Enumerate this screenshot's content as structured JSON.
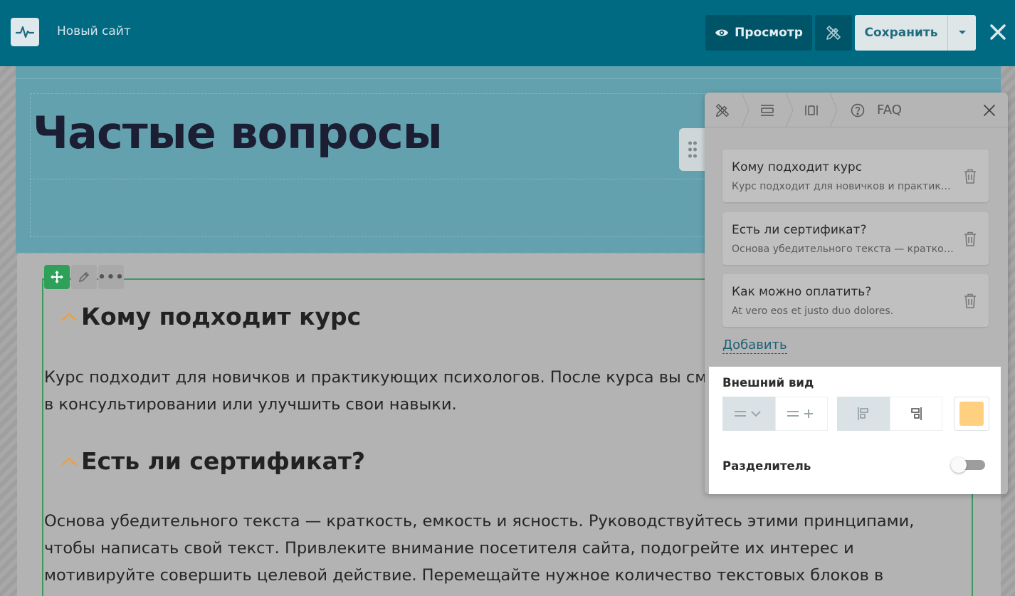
{
  "topbar": {
    "site_name": "Новый сайт",
    "preview_label": "Просмотр",
    "save_label": "Сохранить"
  },
  "hero": {
    "title": "Частые вопросы"
  },
  "faq": {
    "items": [
      {
        "question": "Кому подходит курс",
        "answer_lines": [
          "Курс подходит для новичков и практикующих психологов. После курса вы смож",
          "в консультировании или улучшить свои навыки."
        ]
      },
      {
        "question": "Есть ли сертификат?",
        "answer_lines": [
          "Основа убедительного текста — краткость, емкость и ясность. Руководствуйтесь этими принципами,",
          "чтобы написать свой текст. Привлеките внимание посетителя сайта, подогрейте их интерес и",
          "мотивируйте совершить целевой действие. Перемещайте нужное количество текстовых блоков в"
        ]
      }
    ]
  },
  "panel": {
    "breadcrumb_label": "FAQ",
    "items": [
      {
        "title": "Кому подходит курс",
        "subtitle": "Курс подходит для новичков и практикующих психологов."
      },
      {
        "title": "Есть ли сертификат?",
        "subtitle": "Основа убедительного текста — краткость, емкость и ясность."
      },
      {
        "title": "Как можно оплатить?",
        "subtitle": "At vero eos et justo duo dolores."
      }
    ],
    "add_label": "Добавить",
    "appearance_title": "Внешний вид",
    "separator_label": "Разделитель",
    "separator_on": false,
    "accent_color": "#ffd080"
  },
  "icons": {
    "logo": "pulse-icon",
    "preview": "eye-icon",
    "design": "pencil-ruler-icon",
    "caret": "caret-down-icon",
    "close": "close-icon",
    "move": "move-icon",
    "edit": "pencil-icon",
    "more": "more-icon",
    "chevron": "chevron-up-icon",
    "delete": "trash-icon"
  },
  "colors": {
    "topbar": "#006a83",
    "hero": "#63a1ae",
    "selection": "#3c9a5e",
    "chevron": "#e6a24a"
  }
}
